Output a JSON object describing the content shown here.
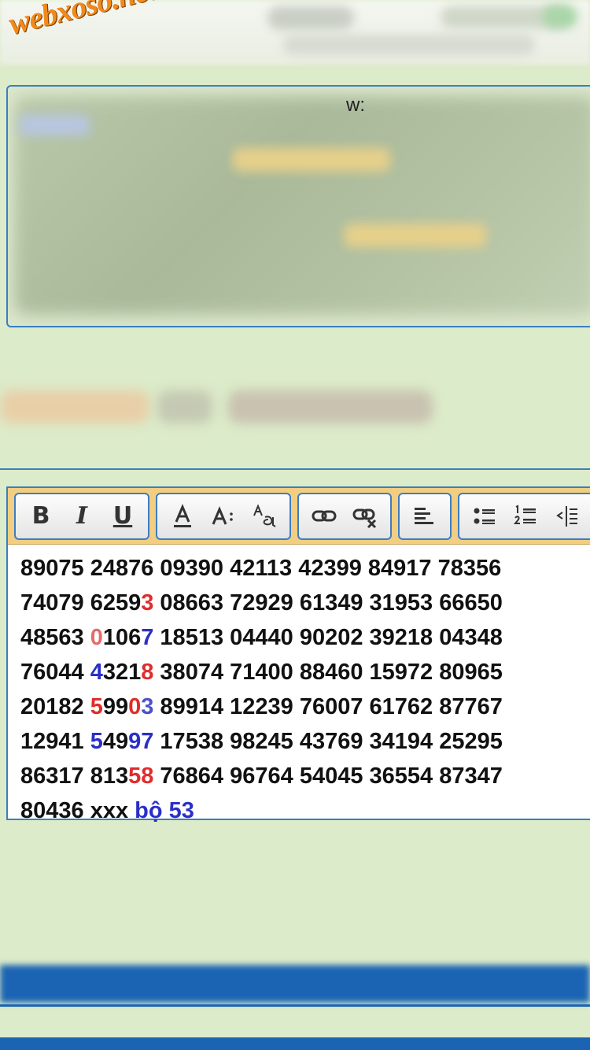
{
  "watermark": "webxoso.net",
  "info_box": {
    "visible_fragment": "w:"
  },
  "toolbar": {
    "groups": [
      [
        {
          "name": "bold-button",
          "label": "B"
        },
        {
          "name": "italic-button",
          "label": "I"
        },
        {
          "name": "underline-button",
          "label": "U"
        }
      ],
      [
        {
          "name": "font-color-button",
          "icon": "font-color-icon"
        },
        {
          "name": "font-size-button",
          "icon": "font-size-icon"
        },
        {
          "name": "font-family-button",
          "icon": "font-family-icon"
        }
      ],
      [
        {
          "name": "link-button",
          "icon": "link-icon"
        },
        {
          "name": "unlink-button",
          "icon": "unlink-icon"
        }
      ],
      [
        {
          "name": "align-left-button",
          "icon": "align-left-icon"
        }
      ],
      [
        {
          "name": "bullet-list-button",
          "icon": "bullet-list-icon"
        },
        {
          "name": "numbered-list-button",
          "icon": "numbered-list-icon"
        },
        {
          "name": "outdent-button",
          "icon": "outdent-icon"
        },
        {
          "name": "indent-button",
          "icon": "indent-icon"
        }
      ]
    ]
  },
  "editor": {
    "lines": [
      [
        {
          "t": "89075 24876 09390 42113 42399 84917 78356"
        }
      ],
      [
        {
          "t": "74079 6259"
        },
        {
          "t": "3",
          "c": "red"
        },
        {
          "t": " 08663 72929 61349 31953 66650"
        }
      ],
      [
        {
          "t": "48563 "
        },
        {
          "t": "0",
          "c": "lred"
        },
        {
          "t": "106"
        },
        {
          "t": "7",
          "c": "blue"
        },
        {
          "t": " 18513 04440 90202 39218 04348"
        }
      ],
      [
        {
          "t": "76044 "
        },
        {
          "t": "4",
          "c": "blue"
        },
        {
          "t": "321"
        },
        {
          "t": "8",
          "c": "red"
        },
        {
          "t": " 38074 71400 88460 15972 80965"
        }
      ],
      [
        {
          "t": "20182 "
        },
        {
          "t": "5",
          "c": "red"
        },
        {
          "t": "99"
        },
        {
          "t": "0",
          "c": "red"
        },
        {
          "t": "3",
          "c": "lblue"
        },
        {
          "t": " 89914 12239 76007 61762 87767"
        }
      ],
      [
        {
          "t": "12941 "
        },
        {
          "t": "5",
          "c": "blue"
        },
        {
          "t": "49"
        },
        {
          "t": "97",
          "c": "blue"
        },
        {
          "t": " 17538 98245 43769 34194 25295"
        }
      ],
      [
        {
          "t": "86317 813"
        },
        {
          "t": "58",
          "c": "red"
        },
        {
          "t": " 76864 96764 54045 36554 87347"
        }
      ],
      [
        {
          "t": "80436 xxx "
        },
        {
          "t": "bộ 53",
          "c": "blue"
        }
      ]
    ]
  },
  "colors": {
    "page_bg": "#dcebc9",
    "accent_blue": "#3a7fbf",
    "toolbar_bg": "#f1ce82",
    "red": "#e02c2c",
    "blue": "#2a2fc8",
    "watermark": "#f08a1c"
  }
}
